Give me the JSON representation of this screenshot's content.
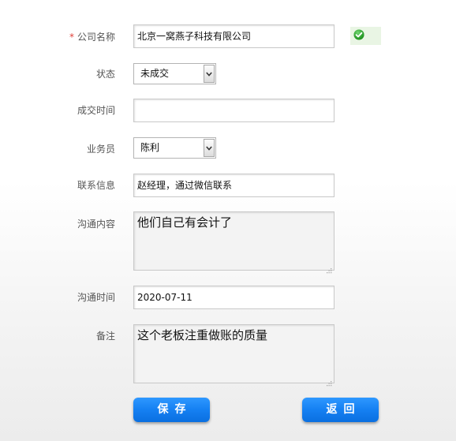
{
  "form": {
    "company_name": {
      "required_mark": "*",
      "label": "公司名称",
      "value": "北京一窝燕子科技有限公司",
      "valid_icon": "check-circle-icon",
      "valid_color": "#2aa52a"
    },
    "status": {
      "label": "状态",
      "selected": "未成交"
    },
    "deal_time": {
      "label": "成交时间",
      "value": ""
    },
    "salesperson": {
      "label": "业务员",
      "selected": "陈利"
    },
    "contact_info": {
      "label": "联系信息",
      "value": "赵经理，通过微信联系"
    },
    "communication_content": {
      "label": "沟通内容",
      "value": "他们自己有会计了"
    },
    "communication_time": {
      "label": "沟通时间",
      "value": "2020-07-11"
    },
    "remarks": {
      "label": "备注",
      "value": "这个老板注重做账的质量"
    }
  },
  "buttons": {
    "save_label": "保存",
    "back_label": "返回",
    "color": "#1580f2"
  }
}
